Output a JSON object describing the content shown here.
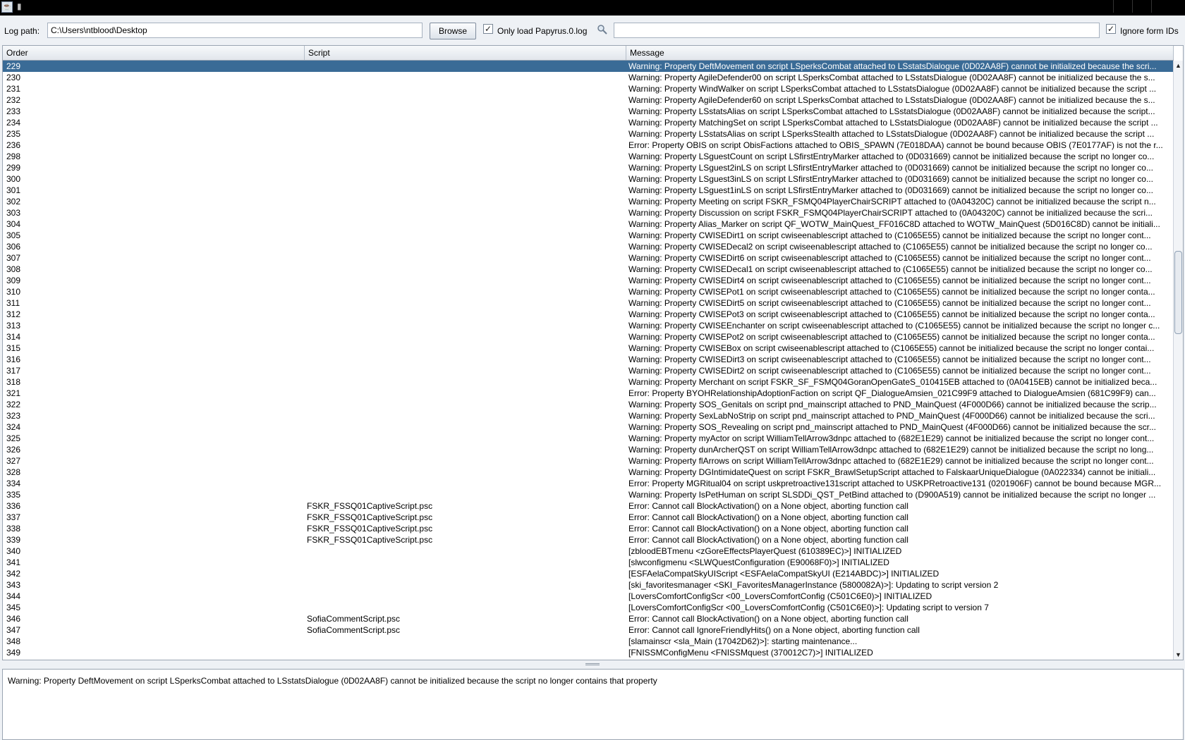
{
  "window": {
    "title": ""
  },
  "toolbar": {
    "log_path_label": "Log path:",
    "log_path_value": "C:\\Users\\ntblood\\Desktop",
    "browse_label": "Browse",
    "only_load_checked": true,
    "only_load_label": "Only load Papyrus.0.log",
    "search_value": "",
    "ignore_ids_checked": true,
    "ignore_ids_label": "Ignore form IDs"
  },
  "table": {
    "columns": [
      "Order",
      "Script",
      "Message"
    ],
    "selected_index": 0,
    "rows": [
      {
        "order": "229",
        "script": "",
        "message": "Warning: Property DeftMovement on script LSperksCombat attached to LSstatsDialogue (0D02AA8F) cannot be initialized because the scri..."
      },
      {
        "order": "230",
        "script": "",
        "message": "Warning: Property AgileDefender00 on script LSperksCombat attached to LSstatsDialogue (0D02AA8F) cannot be initialized because the s..."
      },
      {
        "order": "231",
        "script": "",
        "message": "Warning: Property WindWalker on script LSperksCombat attached to LSstatsDialogue (0D02AA8F) cannot be initialized because the script ..."
      },
      {
        "order": "232",
        "script": "",
        "message": "Warning: Property AgileDefender60 on script LSperksCombat attached to LSstatsDialogue (0D02AA8F) cannot be initialized because the s..."
      },
      {
        "order": "233",
        "script": "",
        "message": "Warning: Property LSstatsAlias on script LSperksCombat attached to LSstatsDialogue (0D02AA8F) cannot be initialized because the script..."
      },
      {
        "order": "234",
        "script": "",
        "message": "Warning: Property MatchingSet on script LSperksCombat attached to LSstatsDialogue (0D02AA8F) cannot be initialized because the script ..."
      },
      {
        "order": "235",
        "script": "",
        "message": "Warning: Property LSstatsAlias on script LSperksStealth attached to LSstatsDialogue (0D02AA8F) cannot be initialized because the script ..."
      },
      {
        "order": "236",
        "script": "",
        "message": "Error: Property OBIS on script ObisFactions attached to OBIS_SPAWN (7E018DAA) cannot be bound because OBIS (7E0177AF) is not the r..."
      },
      {
        "order": "298",
        "script": "",
        "message": "Warning: Property LSguestCount on script LSfirstEntryMarker attached to  (0D031669) cannot be initialized because the script no longer co..."
      },
      {
        "order": "299",
        "script": "",
        "message": "Warning: Property LSguest2inLS on script LSfirstEntryMarker attached to  (0D031669) cannot be initialized because the script no longer co..."
      },
      {
        "order": "300",
        "script": "",
        "message": "Warning: Property LSguest3inLS on script LSfirstEntryMarker attached to  (0D031669) cannot be initialized because the script no longer co..."
      },
      {
        "order": "301",
        "script": "",
        "message": "Warning: Property LSguest1inLS on script LSfirstEntryMarker attached to  (0D031669) cannot be initialized because the script no longer co..."
      },
      {
        "order": "302",
        "script": "",
        "message": "Warning: Property Meeting on script FSKR_FSMQ04PlayerChairSCRIPT attached to  (0A04320C) cannot be initialized because the script n..."
      },
      {
        "order": "303",
        "script": "",
        "message": "Warning: Property Discussion on script FSKR_FSMQ04PlayerChairSCRIPT attached to  (0A04320C) cannot be initialized because the scri..."
      },
      {
        "order": "304",
        "script": "",
        "message": "Warning: Property Alias_Marker on script QF_WOTW_MainQuest_FF016C8D attached to WOTW_MainQuest (5D016C8D) cannot be initiali..."
      },
      {
        "order": "305",
        "script": "",
        "message": "Warning: Property CWISEDirt1 on script cwiseenablescript attached to  (C1065E55) cannot be initialized because the script no longer cont..."
      },
      {
        "order": "306",
        "script": "",
        "message": "Warning: Property CWISEDecal2 on script cwiseenablescript attached to  (C1065E55) cannot be initialized because the script no longer co..."
      },
      {
        "order": "307",
        "script": "",
        "message": "Warning: Property CWISEDirt6 on script cwiseenablescript attached to  (C1065E55) cannot be initialized because the script no longer cont..."
      },
      {
        "order": "308",
        "script": "",
        "message": "Warning: Property CWISEDecal1 on script cwiseenablescript attached to  (C1065E55) cannot be initialized because the script no longer co..."
      },
      {
        "order": "309",
        "script": "",
        "message": "Warning: Property CWISEDirt4 on script cwiseenablescript attached to  (C1065E55) cannot be initialized because the script no longer cont..."
      },
      {
        "order": "310",
        "script": "",
        "message": "Warning: Property CWISEPot1 on script cwiseenablescript attached to  (C1065E55) cannot be initialized because the script no longer conta..."
      },
      {
        "order": "311",
        "script": "",
        "message": "Warning: Property CWISEDirt5 on script cwiseenablescript attached to  (C1065E55) cannot be initialized because the script no longer cont..."
      },
      {
        "order": "312",
        "script": "",
        "message": "Warning: Property CWISEPot3 on script cwiseenablescript attached to  (C1065E55) cannot be initialized because the script no longer conta..."
      },
      {
        "order": "313",
        "script": "",
        "message": "Warning: Property CWISEEnchanter on script cwiseenablescript attached to  (C1065E55) cannot be initialized because the script no longer c..."
      },
      {
        "order": "314",
        "script": "",
        "message": "Warning: Property CWISEPot2 on script cwiseenablescript attached to  (C1065E55) cannot be initialized because the script no longer conta..."
      },
      {
        "order": "315",
        "script": "",
        "message": "Warning: Property CWISEBox on script cwiseenablescript attached to  (C1065E55) cannot be initialized because the script no longer contai..."
      },
      {
        "order": "316",
        "script": "",
        "message": "Warning: Property CWISEDirt3 on script cwiseenablescript attached to  (C1065E55) cannot be initialized because the script no longer cont..."
      },
      {
        "order": "317",
        "script": "",
        "message": "Warning: Property CWISEDirt2 on script cwiseenablescript attached to  (C1065E55) cannot be initialized because the script no longer cont..."
      },
      {
        "order": "318",
        "script": "",
        "message": "Warning: Property Merchant on script FSKR_SF_FSMQ04GoranOpenGateS_010415EB attached to  (0A0415EB) cannot be initialized beca..."
      },
      {
        "order": "321",
        "script": "",
        "message": "Error: Property BYOHRelationshipAdoptionFaction on script QF_DialogueAmsien_021C99F9 attached to DialogueAmsien (681C99F9) can..."
      },
      {
        "order": "322",
        "script": "",
        "message": "Warning: Property SOS_Genitals on script pnd_mainscript attached to PND_MainQuest (4F000D66) cannot be initialized because the scrip..."
      },
      {
        "order": "323",
        "script": "",
        "message": "Warning: Property SexLabNoStrip on script pnd_mainscript attached to PND_MainQuest (4F000D66) cannot be initialized because the scri..."
      },
      {
        "order": "324",
        "script": "",
        "message": "Warning: Property SOS_Revealing on script pnd_mainscript attached to PND_MainQuest (4F000D66) cannot be initialized because the scr..."
      },
      {
        "order": "325",
        "script": "",
        "message": "Warning: Property myActor on script WilliamTellArrow3dnpc attached to  (682E1E29) cannot be initialized because the script no longer cont..."
      },
      {
        "order": "326",
        "script": "",
        "message": "Warning: Property dunArcherQST on script WilliamTellArrow3dnpc attached to  (682E1E29) cannot be initialized because the script no long..."
      },
      {
        "order": "327",
        "script": "",
        "message": "Warning: Property flArrows on script WilliamTellArrow3dnpc attached to  (682E1E29) cannot be initialized because the script no longer cont..."
      },
      {
        "order": "328",
        "script": "",
        "message": "Warning: Property DGIntimidateQuest on script FSKR_BrawlSetupScript attached to FalskaarUniqueDialogue (0A022334) cannot be initiali..."
      },
      {
        "order": "334",
        "script": "",
        "message": "Error: Property MGRitual04 on script uskpretroactive131script attached to USKPRetroactive131 (0201906F) cannot be bound because MGR..."
      },
      {
        "order": "335",
        "script": "",
        "message": "Warning: Property IsPetHuman on script SLSDDi_QST_PetBind attached to  (D900A519) cannot be initialized because the script no longer ..."
      },
      {
        "order": "336",
        "script": "FSKR_FSSQ01CaptiveScript.psc",
        "message": "Error: Cannot call BlockActivation() on a None object, aborting function call"
      },
      {
        "order": "337",
        "script": "FSKR_FSSQ01CaptiveScript.psc",
        "message": "Error: Cannot call BlockActivation() on a None object, aborting function call"
      },
      {
        "order": "338",
        "script": "FSKR_FSSQ01CaptiveScript.psc",
        "message": "Error: Cannot call BlockActivation() on a None object, aborting function call"
      },
      {
        "order": "339",
        "script": "FSKR_FSSQ01CaptiveScript.psc",
        "message": "Error: Cannot call BlockActivation() on a None object, aborting function call"
      },
      {
        "order": "340",
        "script": "",
        "message": "[zbloodEBTmenu <zGoreEffectsPlayerQuest (610389EC)>] INITIALIZED"
      },
      {
        "order": "341",
        "script": "",
        "message": "[slwconfigmenu <SLWQuestConfiguration (E90068F0)>] INITIALIZED"
      },
      {
        "order": "342",
        "script": "",
        "message": "[ESFAelaCompatSkyUIScript <ESFAelaCompatSkyUI (E214ABDC)>] INITIALIZED"
      },
      {
        "order": "343",
        "script": "",
        "message": "[ski_favoritesmanager <SKI_FavoritesManagerInstance (5800082A)>]: Updating to script version 2"
      },
      {
        "order": "344",
        "script": "",
        "message": "[LoversComfortConfigScr <00_LoversComfortConfig (C501C6E0)>] INITIALIZED"
      },
      {
        "order": "345",
        "script": "",
        "message": "[LoversComfortConfigScr <00_LoversComfortConfig (C501C6E0)>]: Updating script to version 7"
      },
      {
        "order": "346",
        "script": "SofiaCommentScript.psc",
        "message": "Error: Cannot call BlockActivation() on a None object, aborting function call"
      },
      {
        "order": "347",
        "script": "SofiaCommentScript.psc",
        "message": "Error: Cannot call IgnoreFriendlyHits() on a None object, aborting function call"
      },
      {
        "order": "348",
        "script": "",
        "message": "[slamainscr <sla_Main (17042D62)>]: starting maintenance..."
      },
      {
        "order": "349",
        "script": "",
        "message": "[FNISSMConfigMenu <FNISSMquest (370012C7)>] INITIALIZED"
      }
    ]
  },
  "detail": {
    "text": "Warning: Property DeftMovement on script LSperksCombat attached to LSstatsDialogue (0D02AA8F) cannot be initialized because the script no longer contains that property"
  },
  "icons": {
    "app": "java-icon",
    "search": "magnifier-icon"
  },
  "colors": {
    "selection": "#3a6b96",
    "titlebar": "#000000"
  }
}
